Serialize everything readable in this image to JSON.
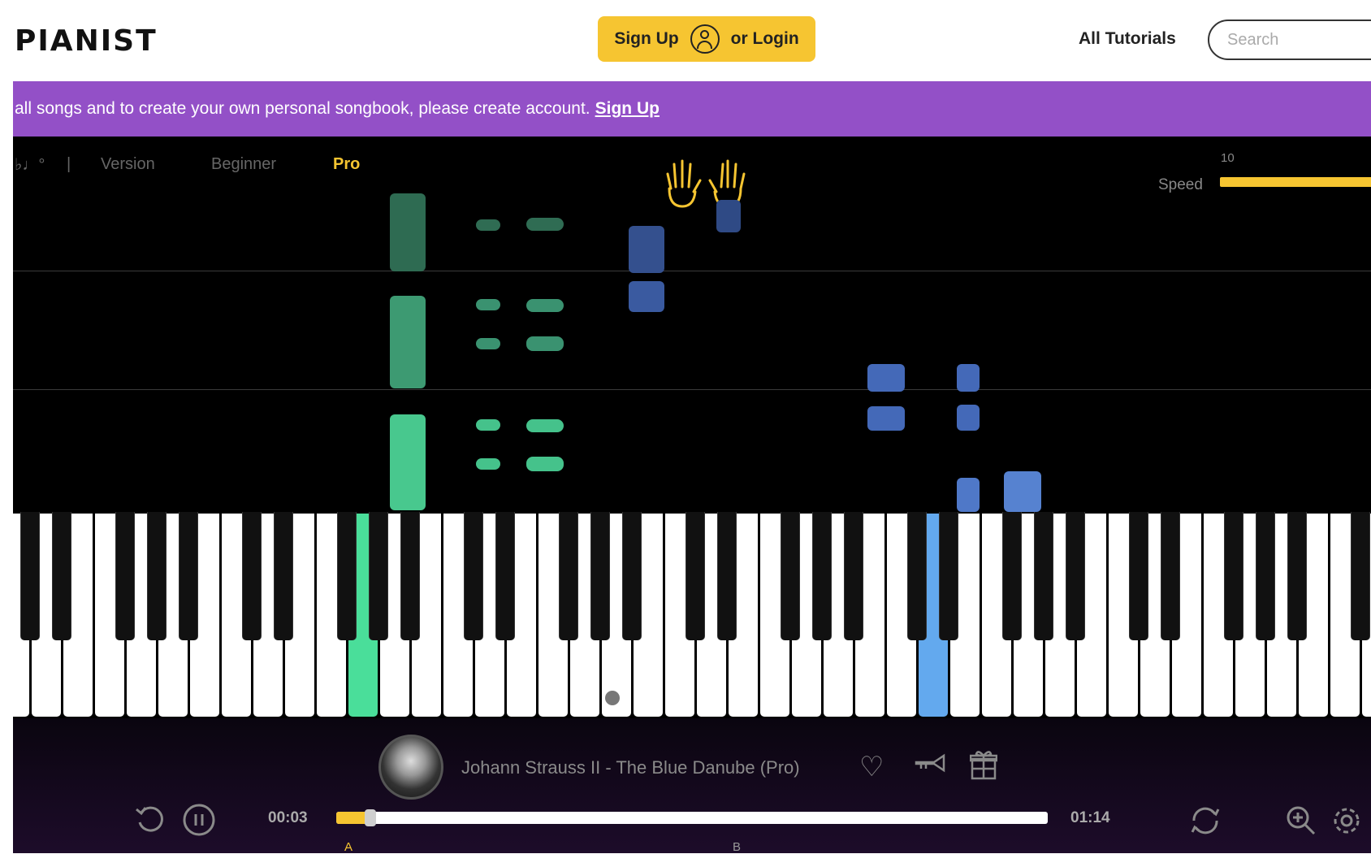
{
  "header": {
    "logo": "PIANIST",
    "signup_label": "Sign Up",
    "login_label": "or Login",
    "all_tutorials": "All Tutorials",
    "search_placeholder": "Search"
  },
  "banner": {
    "text": "all songs and to create your own personal songbook, please create account.",
    "link": "Sign Up"
  },
  "stage": {
    "toolbar": {
      "glyph": "♭♩°",
      "separator": "|",
      "version_label": "Version",
      "beginner_label": "Beginner",
      "pro_label": "Pro"
    },
    "speed_label": "Speed",
    "speed_value": "10",
    "hands": [
      "left-hand-icon",
      "right-hand-icon"
    ]
  },
  "player": {
    "song_title": "Johann Strauss II - The Blue Danube (Pro)",
    "current_time": "00:03",
    "total_time": "01:14",
    "progress": 0.045,
    "marker_a": "A",
    "marker_b": "B",
    "icons": [
      "restart-icon",
      "pause-icon",
      "heart-icon",
      "trumpet-icon",
      "gift-icon",
      "loop-icon",
      "zoom-icon",
      "settings-icon"
    ]
  },
  "colors": {
    "accent": "#f6c531",
    "banner": "#9350c7",
    "left_hand": "#4ade9a",
    "right_hand": "#63a9ee"
  }
}
